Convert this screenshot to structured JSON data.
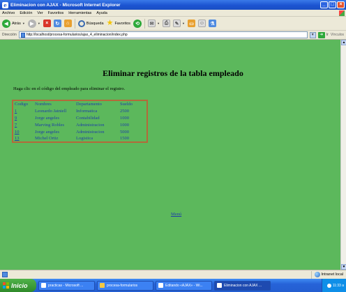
{
  "window": {
    "title": "Eliminacion con AJAX - Microsoft Internet Explorer"
  },
  "menubar": {
    "items": [
      "Archivo",
      "Edición",
      "Ver",
      "Favoritos",
      "Herramientas",
      "Ayuda"
    ]
  },
  "toolbar": {
    "back_label": "Atrás",
    "search_label": "Búsqueda",
    "favorites_label": "Favoritos"
  },
  "address": {
    "label": "Dirección",
    "url": "http://localhost/procesa-formularios/ajax_4_eliminacion/index.php",
    "go_label": "Ir",
    "links_label": "Vínculos"
  },
  "page": {
    "title": "Eliminar registros de la tabla empleado",
    "instructions": "Haga clic en el código del empleado para eliminar el registro.",
    "table": {
      "headers": [
        "Codigo",
        "Nombres",
        "Departamento",
        "Sueldo"
      ],
      "rows": [
        [
          "1",
          "Leonardo Jatniell",
          "Informatica",
          "2500"
        ],
        [
          "9",
          "Jorge angeles",
          "Contabilidad",
          "1000"
        ],
        [
          "7",
          "Marving Robles",
          "Administracion",
          "1000"
        ],
        [
          "10",
          "Jorge angeles",
          "Administracion",
          "5000"
        ],
        [
          "13",
          "Michel Ortiz",
          "Logistica",
          "1500"
        ]
      ]
    },
    "menu_link": "Menú"
  },
  "statusbar": {
    "zone": "Intranet local"
  },
  "taskbar": {
    "start_label": "Inicio",
    "items": [
      "practicas - Microsoft ...",
      "procesa-formularios",
      "Editando «AJAX» - Wi...",
      "Eliminacion con AJAX ..."
    ],
    "clock": "11:33 a"
  },
  "colors": {
    "page_bg": "#5cb85c",
    "link": "#1e3ea8",
    "table_border": "#b36a3a"
  }
}
